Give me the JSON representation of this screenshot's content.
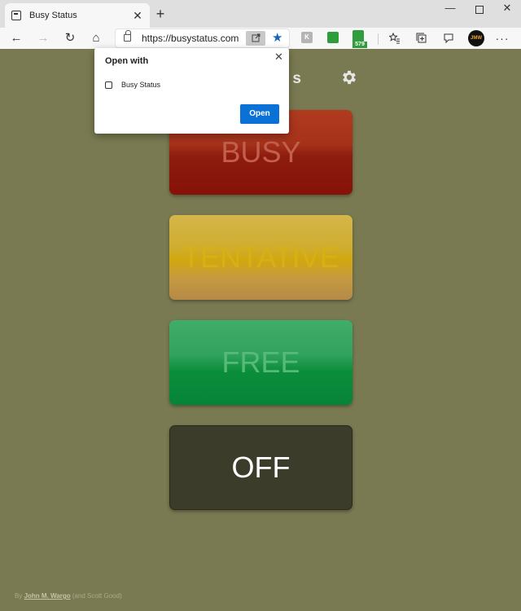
{
  "browser": {
    "tab": {
      "title": "Busy Status",
      "close": "✕"
    },
    "new_tab": "+",
    "window_controls": {
      "minimize": "—",
      "maximize": "",
      "close": "✕"
    },
    "nav": {
      "back": "←",
      "forward": "→",
      "refresh": "↻",
      "home": "⌂"
    },
    "address": {
      "url": "https://busystatus.com",
      "app_available_icon": "open-in-app-icon",
      "favorite": "★"
    },
    "extensions": {
      "ext1": "K",
      "ext2": "",
      "ext3_count": "579"
    },
    "toolbar_icons": [
      "favorites-icon",
      "collections-icon",
      "feedback-icon"
    ],
    "profile": {
      "initials": "JMW"
    },
    "accent": "#1565c0"
  },
  "page": {
    "title": "s",
    "settings_icon": "gear-icon",
    "buttons": {
      "busy": "BUSY",
      "tentative": "TENTATIVE",
      "free": "FREE",
      "off": "OFF"
    },
    "footer": {
      "prefix": "By ",
      "author": "John M. Wargo",
      "suffix": " (and Scott Good)"
    },
    "background": "#7a7a52"
  },
  "popup": {
    "title": "Open with",
    "close": "✕",
    "app_name": "Busy Status",
    "open_label": "Open",
    "button_color": "#0a72d6"
  }
}
